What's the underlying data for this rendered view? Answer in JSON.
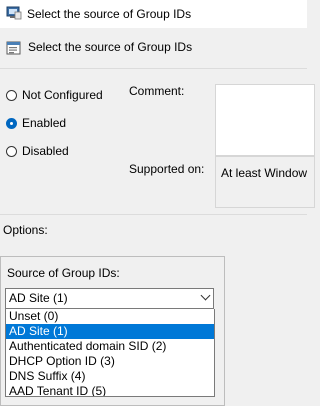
{
  "window": {
    "title": "Select the source of Group IDs"
  },
  "header": {
    "title": "Select the source of Group IDs"
  },
  "state": {
    "options": [
      {
        "label": "Not Configured",
        "checked": false
      },
      {
        "label": "Enabled",
        "checked": true
      },
      {
        "label": "Disabled",
        "checked": false
      }
    ]
  },
  "comment": {
    "label": "Comment:",
    "value": ""
  },
  "supported": {
    "label": "Supported on:",
    "value": "At least Window"
  },
  "options_section": {
    "label": "Options:",
    "field_label": "Source of Group IDs:",
    "selected": "AD Site (1)",
    "items": [
      "Unset (0)",
      "AD Site (1)",
      "Authenticated domain SID (2)",
      "DHCP Option ID (3)",
      "DNS Suffix (4)",
      "AAD Tenant ID (5)"
    ],
    "highlighted_index": 1
  },
  "colors": {
    "accent": "#0078d7",
    "background": "#f0f0f0"
  }
}
